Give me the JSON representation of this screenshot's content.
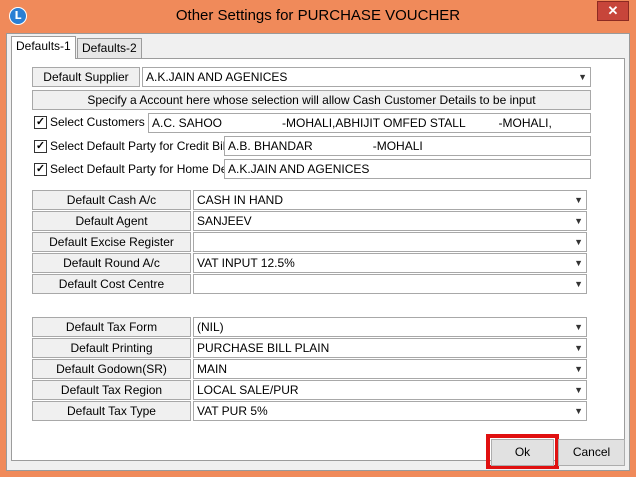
{
  "window": {
    "title": "Other Settings for PURCHASE VOUCHER",
    "app_icon_glyph": "L",
    "close_glyph": "✕"
  },
  "tabs": [
    {
      "label": "Defaults-1"
    },
    {
      "label": "Defaults-2"
    }
  ],
  "supplier": {
    "label": "Default Supplier",
    "value": "A.K.JAIN AND AGENICES"
  },
  "info_text": "Specify a Account here whose selection will allow Cash Customer Details to be input",
  "checks": [
    {
      "label": "Select Customers",
      "checked": true,
      "value": "A.C. SAHOO                  -MOHALI,ABHIJIT OMFED STALL          -MOHALI,"
    },
    {
      "label": "Select Default Party for Credit Bills",
      "checked": true,
      "value": "A.B. BHANDAR                  -MOHALI"
    },
    {
      "label": "Select Default Party for Home Delv",
      "checked": true,
      "value": "A.K.JAIN AND AGENICES"
    }
  ],
  "group1": [
    {
      "label": "Default Cash A/c",
      "value": "CASH IN HAND"
    },
    {
      "label": "Default Agent",
      "value": "SANJEEV"
    },
    {
      "label": "Default Excise Register",
      "value": ""
    },
    {
      "label": "Default Round A/c",
      "value": "VAT INPUT 12.5%"
    },
    {
      "label": "Default Cost Centre",
      "value": ""
    }
  ],
  "group2": [
    {
      "label": "Default Tax Form",
      "value": "(NIL)"
    },
    {
      "label": "Default Printing",
      "value": "PURCHASE BILL PLAIN"
    },
    {
      "label": "Default Godown(SR)",
      "value": "MAIN"
    },
    {
      "label": "Default Tax Region",
      "value": "LOCAL SALE/PUR"
    },
    {
      "label": "Default Tax Type",
      "value": "VAT PUR 5%"
    }
  ],
  "buttons": {
    "ok": "Ok",
    "cancel": "Cancel"
  },
  "colors": {
    "frame": "#f08a5a",
    "highlight": "#e01010"
  },
  "icons": {
    "dropdown": "chevron-down-icon",
    "checkmark": "checkmark-icon"
  }
}
